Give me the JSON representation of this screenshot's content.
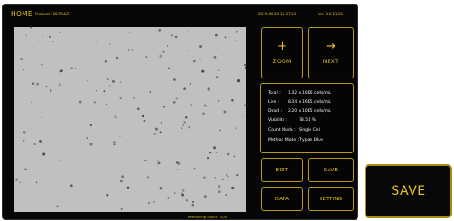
{
  "header": {
    "home": "HOME",
    "protocol": "Protocol : DEFAULT",
    "datetime": "2019.08.30 15:37:33",
    "version": "Ver. 1.0.11.10"
  },
  "controls": {
    "zoom": {
      "icon": "plus-icon",
      "glyph": "+",
      "label": "ZOOM"
    },
    "next": {
      "icon": "arrow-right-icon",
      "glyph": "→",
      "label": "NEXT"
    },
    "edit": "EDIT",
    "save": "SAVE",
    "data": "DATA",
    "setting": "SETTING"
  },
  "results": {
    "total": {
      "label": "Total :",
      "value": "1.02 x 10E6 cells/mL"
    },
    "live": {
      "label": "Live :",
      "value": "8.04 x 10E5 cells/mL"
    },
    "dead": {
      "label": "Dead :",
      "value": "2.20 x 10E5 cells/mL"
    },
    "viability": {
      "label": "Viability :",
      "value": "78.51 %"
    },
    "count_mode": {
      "label": "Count Mode :",
      "value": "Single Cell"
    },
    "method_mode": {
      "label": "Method Mode :",
      "value": "Trypan Blue"
    }
  },
  "footer": {
    "remaining": "Remaining count : 105"
  },
  "zoomed_button": {
    "label": "SAVE"
  },
  "colors": {
    "accent": "#e8c21b",
    "border": "#b89a18",
    "background": "#060606",
    "image": "#c0c0c0"
  }
}
